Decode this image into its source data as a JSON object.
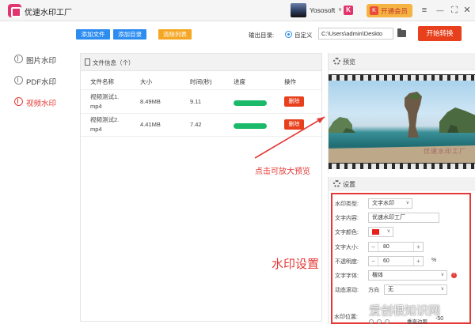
{
  "titlebar": {
    "app_title": "优速水印工厂",
    "username": "Yososoft",
    "caret": "∨",
    "brand_badge": "K",
    "vip_icon": "K",
    "vip_label": "开通会员",
    "menu_glyph": "≡",
    "minimize_glyph": "—",
    "maximize_glyph": "⛶",
    "close_glyph": "✕"
  },
  "sidebar": {
    "items": [
      {
        "label": "图片水印"
      },
      {
        "label": "PDF水印"
      },
      {
        "label": "视频水印"
      }
    ],
    "active_index": 2
  },
  "toolbar": {
    "add_file": "添加文件",
    "add_folder": "添加目录",
    "clear_list": "清除列表",
    "output_label": "输出目录:",
    "custom_label": "自定义",
    "output_path": "C:\\Users\\admin\\Deskto",
    "start": "开始转换"
  },
  "files": {
    "panel_title": "文件信息（个）",
    "headers": [
      "文件名称",
      "大小",
      "时间(秒)",
      "进度",
      "操作"
    ],
    "rows": [
      {
        "name_line1": "视频测试1.",
        "name_line2": "mp4",
        "size": "8.49MB",
        "time": "9.11",
        "progress": 1.0,
        "action": "删除"
      },
      {
        "name_line1": "视频测试2.",
        "name_line2": "mp4",
        "size": "4.41MB",
        "time": "7.42",
        "progress": 1.0,
        "action": "删除"
      }
    ]
  },
  "preview": {
    "title": "预览",
    "watermark_text": "优速水印工厂"
  },
  "settings": {
    "title": "设置",
    "type_label": "水印类型:",
    "type_value": "文字水印",
    "text_label": "文字内容:",
    "text_value": "优速水印工厂",
    "color_label": "文字颜色:",
    "color_value": "#e8201c",
    "size_label": "文字大小:",
    "size_value": "80",
    "opacity_label": "不透明度:",
    "opacity_value": "60",
    "opacity_unit": "%",
    "font_label": "文字字体:",
    "font_value": "楷体",
    "scroll_label": "动态滚动:",
    "direction_label": "方向",
    "direction_value": "无",
    "position_label": "水印位置:",
    "margin_label": "垂直边距",
    "margin_value": "-50",
    "minus": "−",
    "plus": "+",
    "info": "!"
  },
  "annotations": {
    "preview_hint": "点击可放大预览",
    "settings_hint": "水印设置",
    "site_watermark": "爱创根知识网"
  }
}
